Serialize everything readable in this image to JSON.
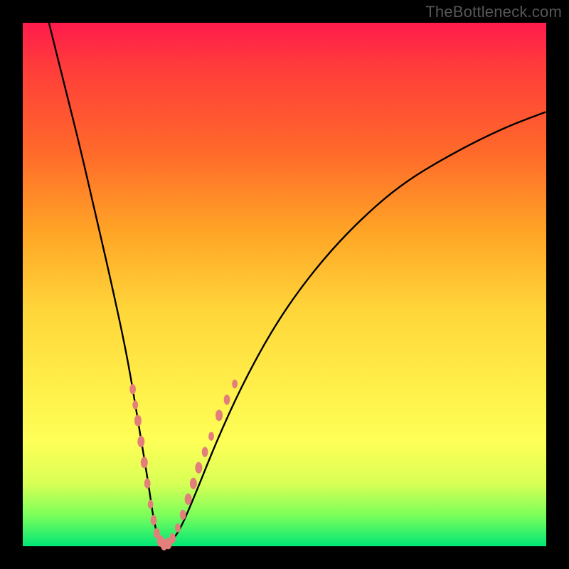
{
  "watermark": "TheBottleneck.com",
  "colors": {
    "frame": "#000000",
    "curve": "#000000",
    "marker_fill": "#e37f7b",
    "marker_stroke": "#e37f7b",
    "gradient_top": "#ff1a4d",
    "gradient_mid": "#fff04a",
    "gradient_bottom": "#00e676"
  },
  "chart_data": {
    "type": "line",
    "title": "",
    "xlabel": "",
    "ylabel": "",
    "xlim": [
      0,
      100
    ],
    "ylim": [
      0,
      100
    ],
    "grid": false,
    "legend": false,
    "series": [
      {
        "name": "bottleneck-curve",
        "x": [
          5,
          8,
          11,
          14,
          17,
          20,
          22,
          24,
          25,
          26,
          27,
          28,
          30,
          33,
          37,
          42,
          48,
          55,
          63,
          72,
          82,
          92,
          100
        ],
        "y": [
          100,
          88,
          76,
          63,
          50,
          36,
          24,
          12,
          5,
          1,
          0,
          0.5,
          3,
          10,
          20,
          31,
          42,
          52,
          61,
          69,
          75,
          80,
          83
        ]
      }
    ],
    "markers": [
      {
        "x": 21.0,
        "y": 30,
        "size": 8
      },
      {
        "x": 21.5,
        "y": 27,
        "size": 7
      },
      {
        "x": 22.0,
        "y": 24,
        "size": 9
      },
      {
        "x": 22.6,
        "y": 20,
        "size": 9
      },
      {
        "x": 23.2,
        "y": 16,
        "size": 9
      },
      {
        "x": 23.8,
        "y": 12,
        "size": 8
      },
      {
        "x": 24.4,
        "y": 8,
        "size": 7
      },
      {
        "x": 25.0,
        "y": 5,
        "size": 8
      },
      {
        "x": 25.6,
        "y": 2.5,
        "size": 8
      },
      {
        "x": 26.3,
        "y": 1,
        "size": 9
      },
      {
        "x": 27.0,
        "y": 0.3,
        "size": 9
      },
      {
        "x": 27.8,
        "y": 0.5,
        "size": 9
      },
      {
        "x": 28.6,
        "y": 1.5,
        "size": 8
      },
      {
        "x": 29.6,
        "y": 3.5,
        "size": 7
      },
      {
        "x": 30.6,
        "y": 6,
        "size": 8
      },
      {
        "x": 31.6,
        "y": 9,
        "size": 9
      },
      {
        "x": 32.6,
        "y": 12,
        "size": 9
      },
      {
        "x": 33.6,
        "y": 15,
        "size": 9
      },
      {
        "x": 34.8,
        "y": 18,
        "size": 8
      },
      {
        "x": 36.0,
        "y": 21,
        "size": 7
      },
      {
        "x": 37.5,
        "y": 25,
        "size": 9
      },
      {
        "x": 39.0,
        "y": 28,
        "size": 8
      },
      {
        "x": 40.5,
        "y": 31,
        "size": 7
      }
    ]
  }
}
